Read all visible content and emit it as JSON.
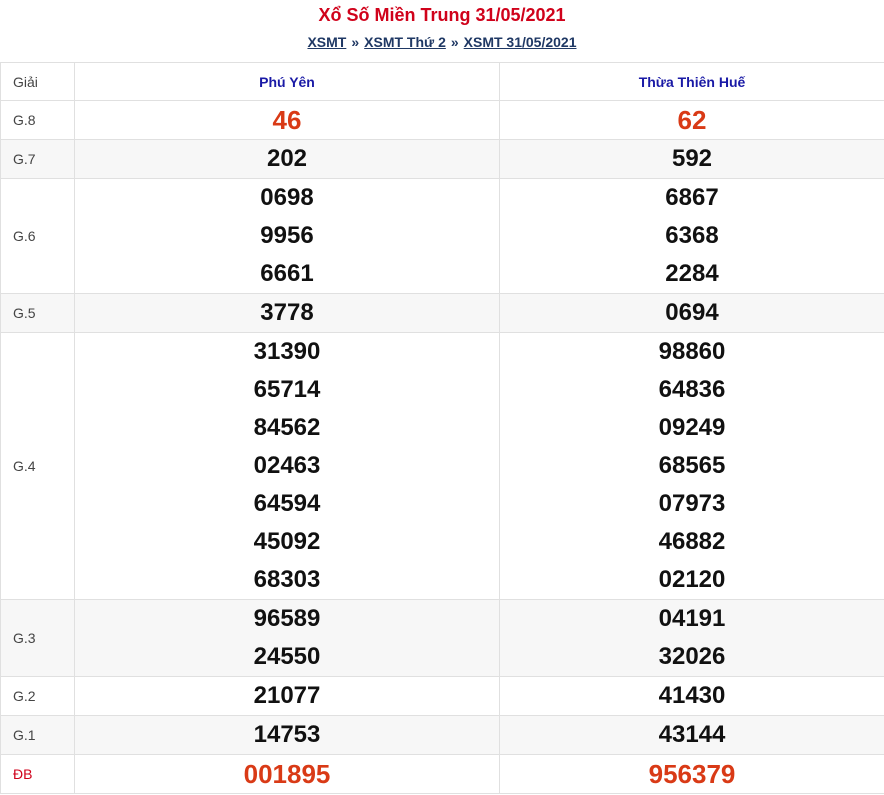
{
  "title": "Xổ Số Miền Trung 31/05/2021",
  "breadcrumb": [
    {
      "label": "XSMT"
    },
    {
      "label": "XSMT Thứ 2"
    },
    {
      "label": "XSMT 31/05/2021"
    }
  ],
  "breadcrumb_sep": "»",
  "table": {
    "header_label": "Giải",
    "provinces": [
      "Phú Yên",
      "Thừa Thiên Huế"
    ],
    "rows": [
      {
        "label": "G.8",
        "a": [
          "46"
        ],
        "b": [
          "62"
        ]
      },
      {
        "label": "G.7",
        "a": [
          "202"
        ],
        "b": [
          "592"
        ]
      },
      {
        "label": "G.6",
        "a": [
          "0698",
          "9956",
          "6661"
        ],
        "b": [
          "6867",
          "6368",
          "2284"
        ]
      },
      {
        "label": "G.5",
        "a": [
          "3778"
        ],
        "b": [
          "0694"
        ]
      },
      {
        "label": "G.4",
        "a": [
          "31390",
          "65714",
          "84562",
          "02463",
          "64594",
          "45092",
          "68303"
        ],
        "b": [
          "98860",
          "64836",
          "09249",
          "68565",
          "07973",
          "46882",
          "02120"
        ]
      },
      {
        "label": "G.3",
        "a": [
          "96589",
          "24550"
        ],
        "b": [
          "04191",
          "32026"
        ]
      },
      {
        "label": "G.2",
        "a": [
          "21077"
        ],
        "b": [
          "41430"
        ]
      },
      {
        "label": "G.1",
        "a": [
          "14753"
        ],
        "b": [
          "43144"
        ]
      },
      {
        "label": "ĐB",
        "a": [
          "001895"
        ],
        "b": [
          "956379"
        ]
      }
    ]
  },
  "colors": {
    "title": "#d0021b",
    "prize_highlight": "#d93a16",
    "province": "#1a1aa6",
    "breadcrumb": "#1f3864"
  }
}
